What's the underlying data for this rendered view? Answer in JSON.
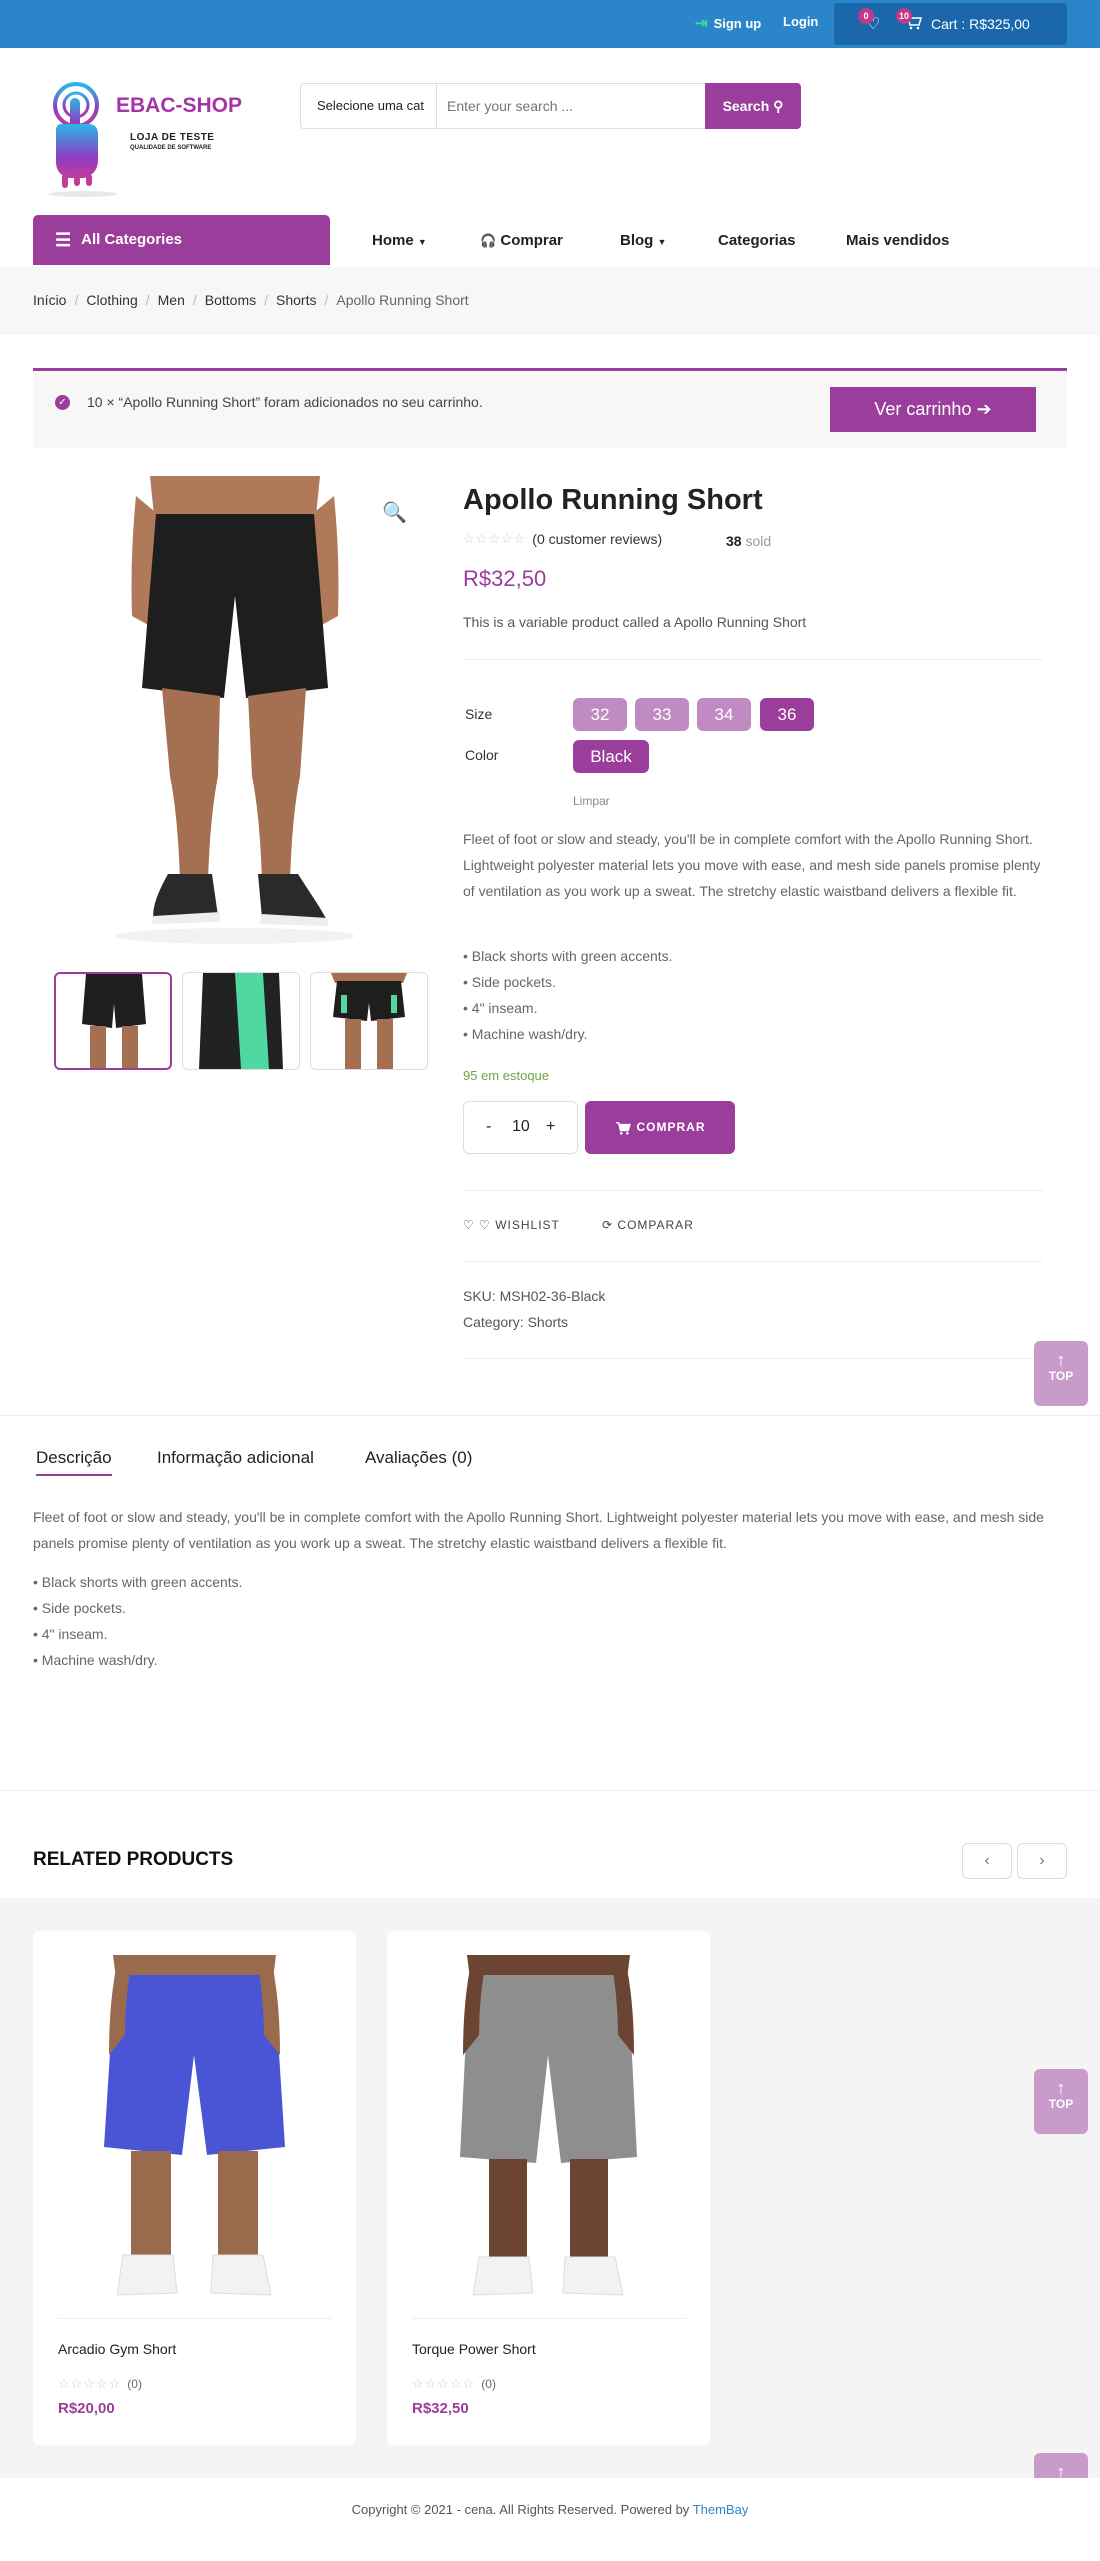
{
  "topbar": {
    "signup": "Sign up",
    "login": "Login",
    "wishlist_count": "0",
    "cart_count": "10",
    "cart_total": "Cart : R$325,00"
  },
  "header": {
    "brand": "EBAC-SHOP",
    "tagline": "LOJA DE TESTE",
    "tagline_sub": "QUALIDADE DE SOFTWARE",
    "category_select": "Selecione uma cat",
    "search_placeholder": "Enter your search ...",
    "search_button": "Search"
  },
  "nav": {
    "all_categories": "All Categories",
    "items": [
      "Home",
      "Comprar",
      "Blog",
      "Categorias",
      "Mais vendidos"
    ]
  },
  "breadcrumb": [
    "Início",
    "Clothing",
    "Men",
    "Bottoms",
    "Shorts",
    "Apollo Running Short"
  ],
  "notice": {
    "message": "10 × “Apollo Running Short” foram adicionados no seu carrinho.",
    "button": "Ver carrinho"
  },
  "product": {
    "title": "Apollo Running Short",
    "reviews": "(0 customer reviews)",
    "sold_count": "38",
    "sold_label": "sold",
    "price": "R$32,50",
    "short_description": "This is a variable product called a Apollo Running Short",
    "size_label": "Size",
    "sizes": [
      "32",
      "33",
      "34",
      "36"
    ],
    "selected_size": "36",
    "color_label": "Color",
    "color": "Black",
    "clear": "Limpar",
    "description": "Fleet of foot or slow and steady, you'll be in complete comfort with the Apollo Running Short. Lightweight polyester material lets you move with ease, and mesh side panels promise plenty of ventilation as you work up a sweat. The stretchy elastic waistband delivers a flexible fit.",
    "features": [
      "• Black shorts with green accents.",
      "• Side pockets.",
      "• 4\" inseam.",
      "• Machine wash/dry."
    ],
    "stock": "95 em estoque",
    "quantity": "10",
    "buy_button": "COMPRAR",
    "wishlist": "WISHLIST",
    "compare": "COMPARAR",
    "sku": "SKU: MSH02-36-Black",
    "category_label": "Category:",
    "category": "Shorts"
  },
  "tabs": {
    "items": [
      "Descrição",
      "Informação adicional",
      "Avaliações (0)"
    ],
    "active": "Descrição",
    "description": "Fleet of foot or slow and steady, you'll be in complete comfort with the Apollo Running Short. Lightweight polyester material lets you move with ease, and mesh side panels promise plenty of ventilation as you work up a sweat. The stretchy elastic waistband delivers a flexible fit.",
    "features": [
      "• Black shorts with green accents.",
      "• Side pockets.",
      "• 4\" inseam.",
      "• Machine wash/dry."
    ]
  },
  "related": {
    "title": "RELATED PRODUCTS",
    "products": [
      {
        "name": "Arcadio Gym Short",
        "reviews": "(0)",
        "price": "R$20,00",
        "color": "#4a55d6"
      },
      {
        "name": "Torque Power Short",
        "reviews": "(0)",
        "price": "R$32,50",
        "color": "#8e8e8e"
      }
    ]
  },
  "back_to_top": "TOP",
  "footer": {
    "text": "Copyright © 2021 - cena. All Rights Reserved. Powered by",
    "link": "ThemBay"
  },
  "colors": {
    "accent": "#9b3d9b",
    "topbar": "#2a86c9",
    "stock": "#6aa64a"
  }
}
